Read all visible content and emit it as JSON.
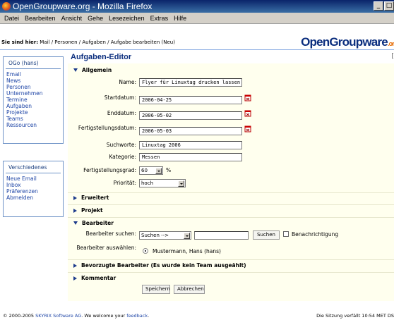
{
  "window": {
    "title": "OpenGroupware.org - Mozilla Firefox"
  },
  "menubar": [
    "Datei",
    "Bearbeiten",
    "Ansicht",
    "Gehe",
    "Lesezeichen",
    "Extras",
    "Hilfe"
  ],
  "breadcrumb": {
    "prefix": "Sie sind hier:",
    "path": "Mail / Personen / Aufgaben / Aufgabe bearbeiten (Neu)"
  },
  "logo": {
    "main": "OpenGroupware",
    "suffix": ".or"
  },
  "sidebar": {
    "apps_header": "OGo (hans)",
    "apps": [
      "Email",
      "News",
      "Personen",
      "Unternehmen",
      "Termine",
      "Aufgaben",
      "Projekte",
      "Teams",
      "Ressourcen"
    ],
    "misc_header": "Verschiedenes",
    "misc": [
      "Neue Email",
      "Inbox",
      "Präferenzen",
      "Abmelden"
    ]
  },
  "editor": {
    "title": "Aufgaben-Editor",
    "sections": {
      "allgemein": "Allgemein",
      "erweitert": "Erweitert",
      "projekt": "Projekt",
      "bearbeiter": "Bearbeiter",
      "bevorzugte": "Bevorzugte Bearbeiter (Es wurde kein Team ausgeählt)",
      "kommentar": "Kommentar"
    },
    "fields": {
      "name_label": "Name:",
      "name_value": "Flyer für Linuxtag drucken lassen",
      "start_label": "Startdatum:",
      "start_value": "2006-04-25",
      "end_label": "Enddatum:",
      "end_value": "2006-05-02",
      "done_label": "Fertigstellungsdatum:",
      "done_value": "2006-05-03",
      "keywords_label": "Suchworte:",
      "keywords_value": "Linuxtag 2006",
      "category_label": "Kategorie:",
      "category_value": "Messen",
      "progress_label": "Fertigstellungsgrad:",
      "progress_value": "60",
      "progress_unit": "%",
      "priority_label": "Priorität:",
      "priority_value": "hoch"
    },
    "bearbeiter": {
      "search_label": "Bearbeiter suchen:",
      "search_select": "Suchen -->",
      "search_button": "Suchen",
      "notify_label": "Benachrichtigung",
      "choose_label": "Bearbeiter auswählen:",
      "chosen": "Mustermann, Hans (hans)"
    },
    "buttons": {
      "save": "Speichern",
      "cancel": "Abbrechen"
    }
  },
  "footer": {
    "copyright_prefix": "© 2000-2005",
    "company": "SKYRIX Software AG",
    "welcome": ". We welcome your",
    "feedback": "feedback",
    "end": ".",
    "session": "Die Sitzung verfällt 10:54 MET DS"
  },
  "colors": {
    "titlebar": "#0a246a",
    "link": "#1e45a6",
    "panel": "#ffffee",
    "accent": "#e66a00"
  }
}
